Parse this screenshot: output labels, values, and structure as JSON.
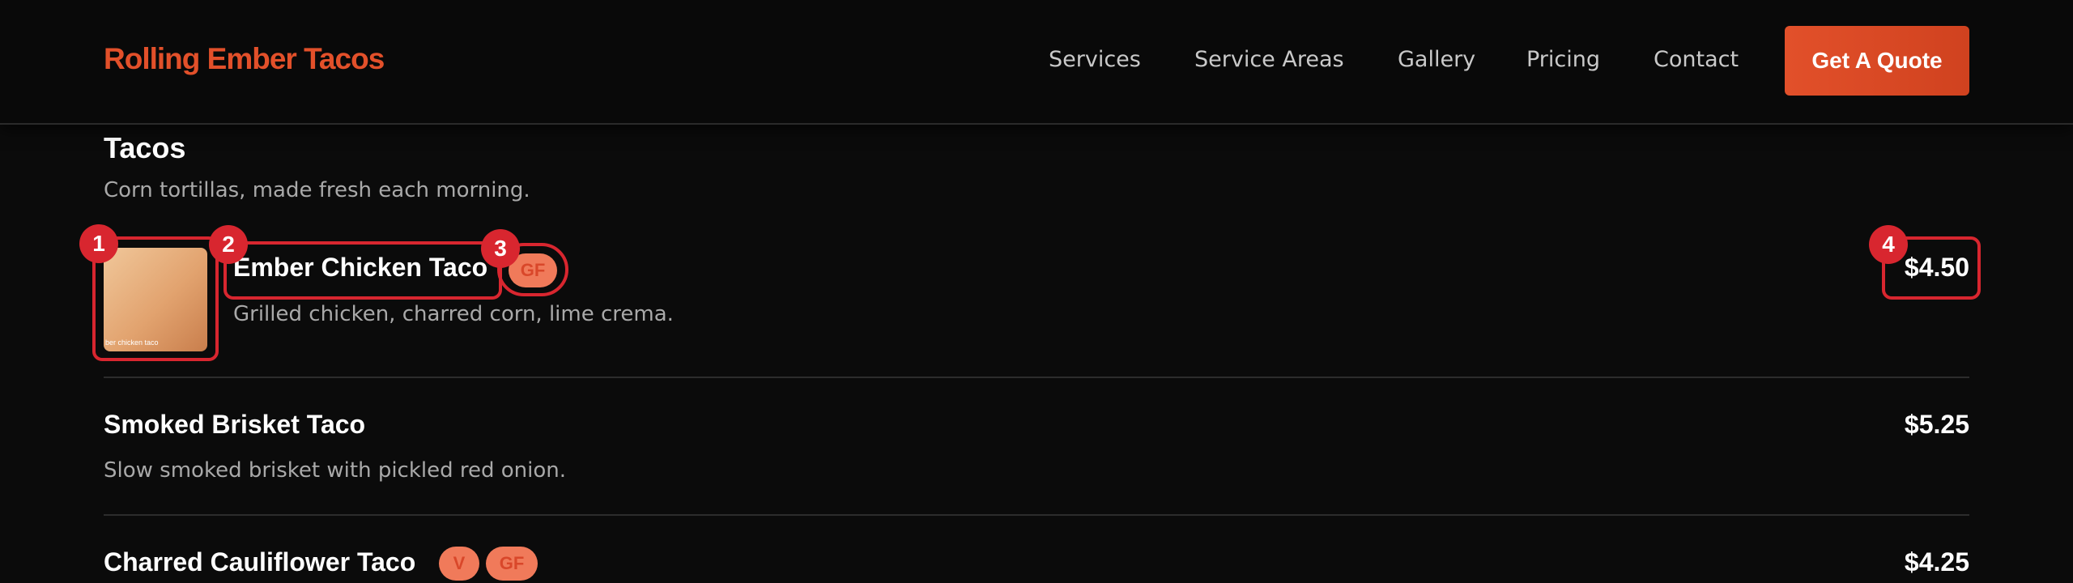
{
  "header": {
    "brand": "Rolling Ember Tacos",
    "nav": [
      "Services",
      "Service Areas",
      "Gallery",
      "Pricing",
      "Contact"
    ],
    "cta_label": "Get A Quote"
  },
  "section": {
    "title": "Tacos",
    "subtitle": "Corn tortillas, made fresh each morning."
  },
  "items": [
    {
      "name": "Ember Chicken Taco",
      "desc": "Grilled chicken, charred corn, lime crema.",
      "price": "$4.50",
      "tags": [
        "GF"
      ],
      "thumb_label": "ber chicken taco"
    },
    {
      "name": "Smoked Brisket Taco",
      "desc": "Slow smoked brisket with pickled red onion.",
      "price": "$5.25",
      "tags": []
    },
    {
      "name": "Charred Cauliflower Taco",
      "desc": "",
      "price": "$4.25",
      "tags": [
        "V",
        "GF"
      ]
    }
  ],
  "annotations": [
    "1",
    "2",
    "3",
    "4"
  ],
  "colors": {
    "accent": "#e2502a",
    "tag_bg": "#f07a5a",
    "highlight": "#d8262f",
    "background": "#0b0b0b"
  }
}
